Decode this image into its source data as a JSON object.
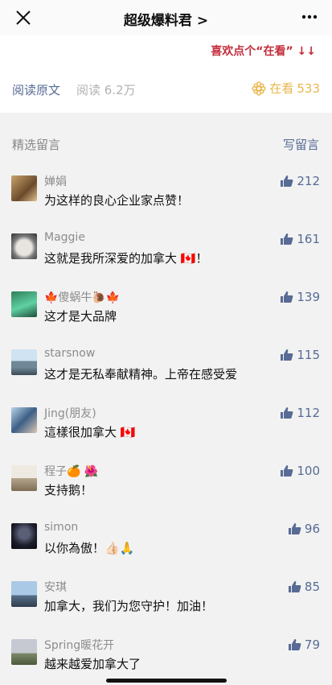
{
  "nav": {
    "title": "超级爆料君 >"
  },
  "article": {
    "like_hint": "喜欢点个“在看” ↓↓",
    "read_original": "阅读原文",
    "read_count": "阅读 6.2万",
    "zaikan_label": "在看",
    "zaikan_count": "533"
  },
  "comments": {
    "section_label": "精选留言",
    "write_label": "写留言",
    "items": [
      {
        "name": "婵娟",
        "text": "为这样的良心企业家点赞！",
        "likes": "212"
      },
      {
        "name": "Maggie",
        "text": "这就是我所深爱的加拿大 🇨🇦！",
        "likes": "161"
      },
      {
        "name": "🍁傻蜗牛🐌🍁",
        "text": "这才是大品牌",
        "likes": "139"
      },
      {
        "name": "starsnow",
        "text": "这才是无私奉献精神。上帝在感受爱",
        "likes": "115"
      },
      {
        "name": "Jing(朋友)",
        "text": "這樣很加拿大 🇨🇦",
        "likes": "112"
      },
      {
        "name": "程子🍊 🌺",
        "text": "支持鹅！",
        "likes": "100"
      },
      {
        "name": "simon",
        "text": "以你為傲！👍🏻🙏",
        "likes": "96"
      },
      {
        "name": "安琪",
        "text": "加拿大，我们为您守护！加油！",
        "likes": "85"
      },
      {
        "name": "Spring暖花开",
        "text": "越来越爱加拿大了",
        "likes": "79"
      }
    ]
  },
  "colors": {
    "link": "#576b95",
    "accent_red": "#c32c3a",
    "zaikan_gold": "#e9b64a"
  }
}
